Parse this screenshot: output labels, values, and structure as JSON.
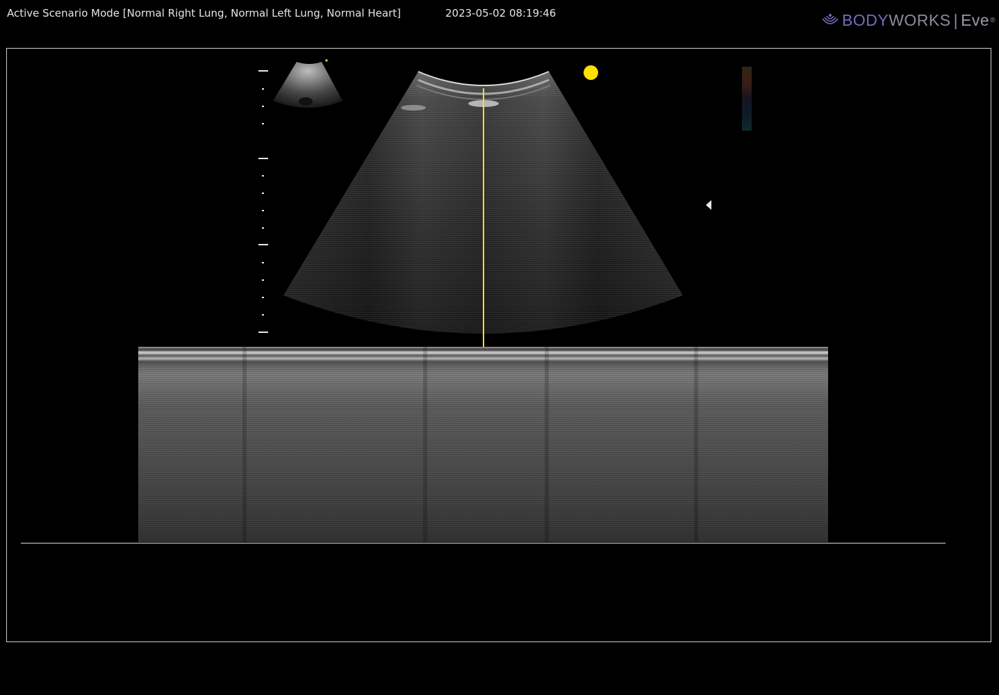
{
  "header": {
    "scenario": "Active Scenario Mode [Normal Right Lung, Normal Left Lung, Normal Heart]",
    "timestamp": "2023-05-02 08:19:46"
  },
  "brand": {
    "body": "BODY",
    "works": "WORKS",
    "separator": "|",
    "product": "Eve",
    "reg": "®",
    "icon": "ultrasound-waves-icon",
    "colors": {
      "body": "#6f6fc0",
      "works": "#8c8c9c"
    }
  },
  "ultrasound": {
    "mline_color": "#f2e21a",
    "focus_dot_color": "#ffe000",
    "icons": {
      "focus_marker": "triangle-left-icon",
      "focus_dot": "yellow-dot-icon"
    }
  }
}
